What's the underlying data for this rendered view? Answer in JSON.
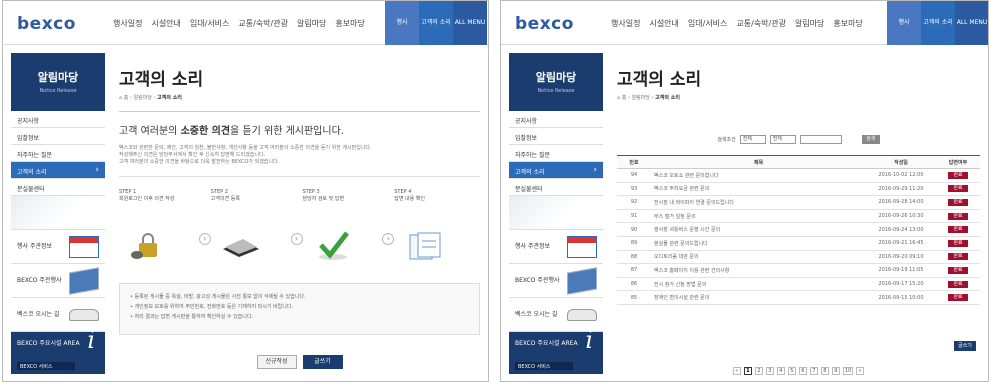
{
  "logo": "bexco",
  "gnb": [
    "행사일정",
    "시설안내",
    "임대/서비스",
    "교통/숙박/관광",
    "알림마당",
    "홍보마당"
  ],
  "top_buttons": [
    {
      "label": "행사",
      "color": "#4a77c2"
    },
    {
      "label": "고객의 소리",
      "color": "#2c6bb8"
    },
    {
      "label": "ALL MENU",
      "color": "#2c5aa0"
    }
  ],
  "sidebar": {
    "title": "알림마당",
    "subtitle": "Notice Release",
    "menu": [
      {
        "label": "공지사항"
      },
      {
        "label": "입찰정보"
      },
      {
        "label": "자주하는 질문"
      },
      {
        "label": "고객의 소리",
        "active": true
      },
      {
        "label": "분실물센터"
      }
    ],
    "banners": [
      "행사 주관정보",
      "BEXCO 주관행사",
      "벡스코 오시는 길"
    ],
    "footer": {
      "title": "BEXCO 주요시설 AREA",
      "bar": "BEXCO 서비스"
    }
  },
  "left": {
    "title": "고객의 소리",
    "breadcrumb_home": "홈",
    "breadcrumb_mid": "알림마당",
    "breadcrumb_cur": "고객의 소리",
    "intro_pre": "고객 여러분의 ",
    "intro_bold": "소중한 의견",
    "intro_post": "을 듣기 위한 게시판입니다.",
    "lines": [
      "벡스코와 관련한 문의, 제안, 고객의 칭찬, 불만사항, 개선사항 등을 고객 여러분의 소중한 의견을 듣기 위한 게시판입니다.",
      "작성해주신 의견은 담당부서에서 확인 후 신속히 답변해 드리겠습니다.",
      "고객 여러분의 소중한 의견을 바탕으로 더욱 발전하는 BEXCO가 되겠습니다."
    ],
    "steps": [
      {
        "title": "STEP 1",
        "desc": "회원로그인 이후 의견 작성"
      },
      {
        "title": "STEP 2",
        "desc": "고객의견 등록"
      },
      {
        "title": "STEP 3",
        "desc": "담당자 검토 및 답변"
      },
      {
        "title": "STEP 4",
        "desc": "답변 내용 확인"
      }
    ],
    "notes": [
      "등록된 게시물 중 욕설, 비방, 광고성 게시물은 사전 통보 없이 삭제될 수 있습니다.",
      "개인정보 보호를 위하여 주민번호, 전화번호 등은 기재하지 마시기 바랍니다.",
      "처리 결과는 답변 게시판을 통하여 확인하실 수 있습니다."
    ],
    "btn_cancel": "신규작성",
    "btn_write": "글쓰기"
  },
  "right": {
    "title": "고객의 소리",
    "breadcrumb_home": "홈",
    "breadcrumb_mid": "알림마당",
    "breadcrumb_cur": "고객의 소리",
    "search_label": "검색조건",
    "search_sel1": "전체",
    "search_sel2": "전체",
    "search_btn": "검색",
    "headers": [
      "번호",
      "제목",
      "작성일",
      "답변여부"
    ],
    "rows": [
      {
        "no": "94",
        "title": "벡스코 오토쇼 관련 문의합니다",
        "date": "2016-10-02 12:00",
        "status": "완료"
      },
      {
        "no": "93",
        "title": "벡스코 주차요금 관련 문의",
        "date": "2016-09-29 11:20",
        "status": "완료"
      },
      {
        "no": "92",
        "title": "전시장 내 와이파이 연결 문의드립니다",
        "date": "2016-09-28 14:00",
        "status": "완료"
      },
      {
        "no": "91",
        "title": "부스 철거 일정 문의",
        "date": "2016-09-26 10:30",
        "status": "완료"
      },
      {
        "no": "90",
        "title": "행사장 셔틀버스 운행 시간 문의",
        "date": "2016-09-24 13:00",
        "status": "완료"
      },
      {
        "no": "89",
        "title": "분실물 관련 문의드립니다",
        "date": "2016-09-21 16:45",
        "status": "완료"
      },
      {
        "no": "88",
        "title": "오디토리움 대관 문의",
        "date": "2016-09-20 09:10",
        "status": "완료"
      },
      {
        "no": "87",
        "title": "벡스코 홈페이지 이용 관련 건의사항",
        "date": "2016-09-19 11:05",
        "status": "완료"
      },
      {
        "no": "86",
        "title": "전시 참가 신청 방법 문의",
        "date": "2016-09-17 15:20",
        "status": "완료"
      },
      {
        "no": "85",
        "title": "장애인 편의시설 관련 문의",
        "date": "2016-09-15 10:00",
        "status": "완료"
      }
    ],
    "write_btn": "글쓰기",
    "pages": [
      "«",
      "1",
      "2",
      "3",
      "4",
      "5",
      "6",
      "7",
      "8",
      "9",
      "10",
      "»"
    ]
  }
}
